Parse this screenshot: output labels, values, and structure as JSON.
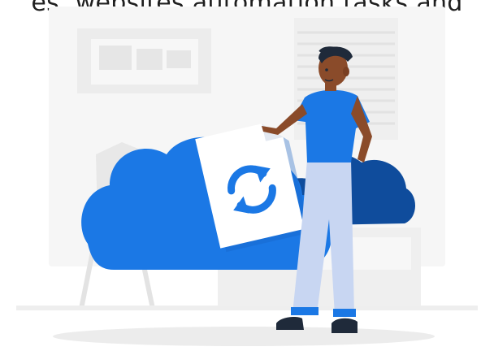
{
  "caption": {
    "text": "es, websites automation tasks and"
  },
  "illustration": {
    "subject": "cloud-sync",
    "icons": [
      "sync-icon",
      "cloud-icon",
      "document-icon"
    ],
    "colors": {
      "cloud_front": "#1b78e5",
      "cloud_back": "#0f4c9c",
      "document": "#ffffff",
      "document_fold": "#e9edf3",
      "sync_arrows": "#1b78e5",
      "shirt": "#1b78e5",
      "pants": "#c8d6f2",
      "skin": "#8a4b2a",
      "hair": "#1f2a3a",
      "shoes": "#1f2a3a",
      "background_shapes": "#f3f3f3"
    }
  }
}
